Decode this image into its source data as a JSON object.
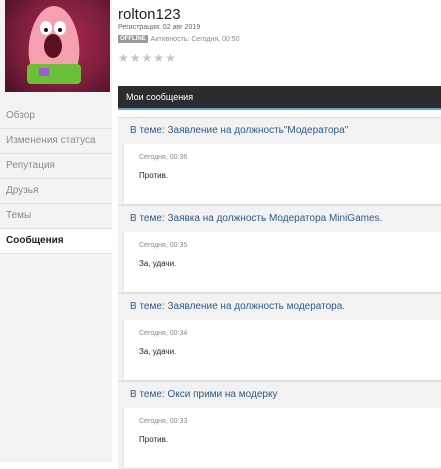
{
  "profile": {
    "username": "rolton123",
    "registration": "Регистрация: 02 авг 2019",
    "status_badge": "OFFLINE",
    "activity": "Активность: Сегодня, 00:50",
    "rating_stars": 0
  },
  "sidebar": {
    "items": [
      {
        "label": "Обзор"
      },
      {
        "label": "Изменения статуса"
      },
      {
        "label": "Репутация"
      },
      {
        "label": "Друзья"
      },
      {
        "label": "Темы"
      },
      {
        "label": "Сообщения"
      }
    ],
    "active_index": 5
  },
  "main": {
    "section_title": "Мои сообщения",
    "posts": [
      {
        "title": "В теме: Заявление на должность\"Модератора\"",
        "date": "Сегодня, 00:36",
        "text": "Против."
      },
      {
        "title": "В теме: Заявка на должность Модератора MiniGames.",
        "date": "Сегодня, 00:35",
        "text": "За, удачи."
      },
      {
        "title": "В теме: Заявление на должность модератора.",
        "date": "Сегодня, 00:34",
        "text": "За, удачи."
      },
      {
        "title": "В теме: Окси прими на модерку",
        "date": "Сегодня, 00:33",
        "text": "Против."
      }
    ]
  },
  "colors": {
    "header_bg": "#2a2c2e",
    "accent_line": "#6ba3cc",
    "link": "#2e5a8a",
    "avatar_bg": "#7a1e3c"
  }
}
